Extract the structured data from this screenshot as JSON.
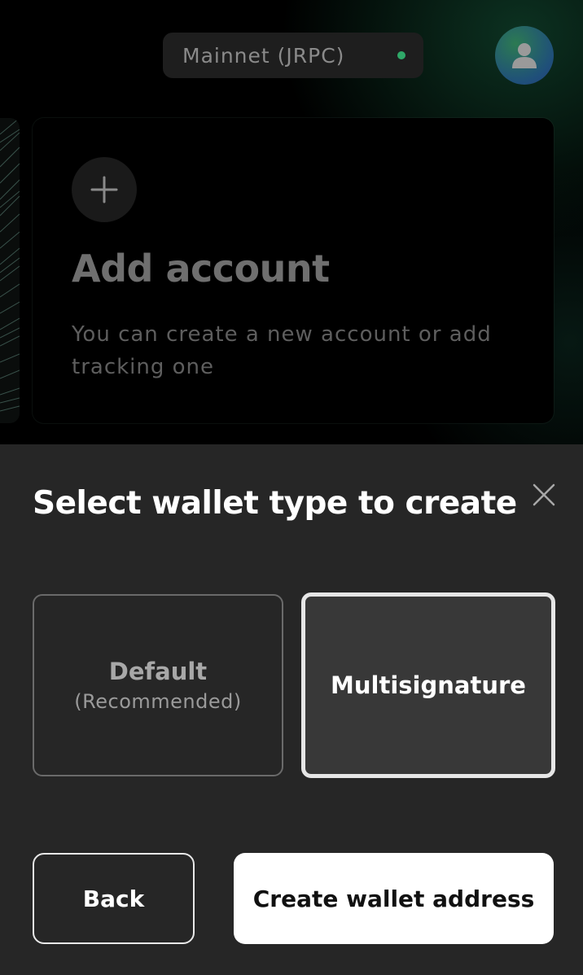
{
  "header": {
    "network_label": "Mainnet (JRPC)",
    "network_status_color": "#2fa868",
    "avatar_icon": "user-icon"
  },
  "add_account_card": {
    "icon": "plus-icon",
    "title": "Add account",
    "description": "You can create a new account or add tracking one"
  },
  "sheet": {
    "title": "Select wallet type to create",
    "close_icon": "close-icon",
    "options": [
      {
        "label": "Default",
        "sublabel": "(Recommended)",
        "selected": false
      },
      {
        "label": "Multisignature",
        "selected": true
      }
    ],
    "back_label": "Back",
    "create_label": "Create wallet address"
  },
  "colors": {
    "sheet_background": "#262626",
    "primary_button": "#ffffff",
    "accent_glow": "#165a3c"
  }
}
